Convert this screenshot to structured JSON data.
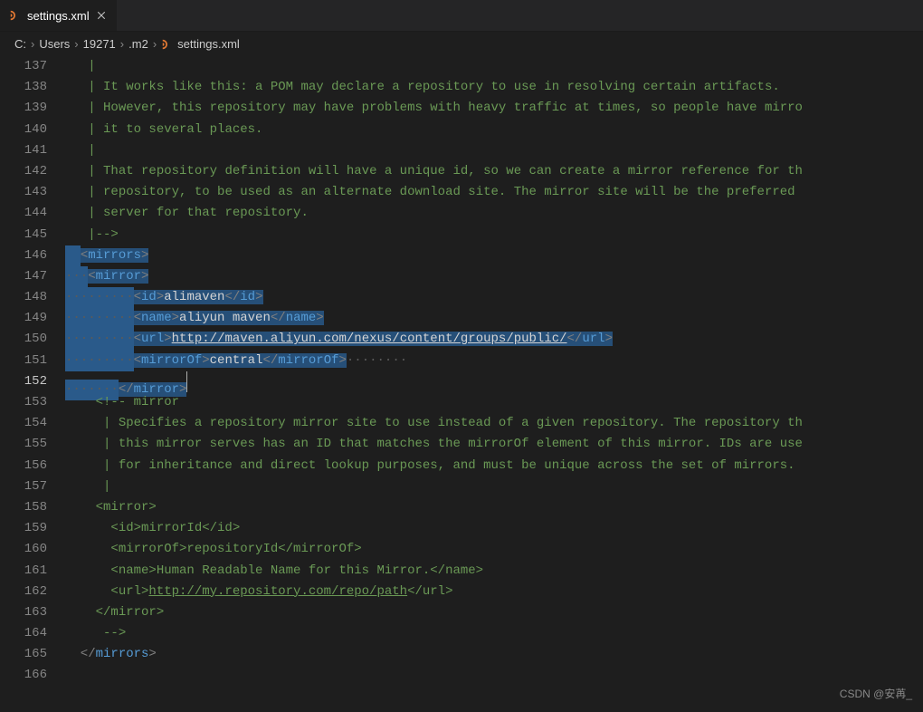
{
  "tab": {
    "filename": "settings.xml"
  },
  "breadcrumb": {
    "parts": [
      "C:",
      "Users",
      "19271",
      ".m2"
    ],
    "file": "settings.xml"
  },
  "lines": {
    "start": 137,
    "end": 166,
    "active": 152
  },
  "code": {
    "l137": "|",
    "l138": "| It works like this: a POM may declare a repository to use in resolving certain artifacts.",
    "l139": "| However, this repository may have problems with heavy traffic at times, so people have mirro",
    "l140": "| it to several places.",
    "l141": "|",
    "l142": "| That repository definition will have a unique id, so we can create a mirror reference for th",
    "l143": "| repository, to be used as an alternate download site. The mirror site will be the preferred",
    "l144": "| server for that repository.",
    "l145": "|-->",
    "mirrors_open": "mirrors",
    "mirror_open": "mirror",
    "id_tag": "id",
    "id_val": "alimaven",
    "name_tag": "name",
    "name_val": "aliyun maven",
    "url_tag": "url",
    "url_val": "http://maven.aliyun.com/nexus/content/groups/public/",
    "mirrorof_tag": "mirrorOf",
    "mirrorof_val": "central",
    "l153": "<!-- mirror",
    "l154": " | Specifies a repository mirror site to use instead of a given repository. The repository th",
    "l155": " | this mirror serves has an ID that matches the mirrorOf element of this mirror. IDs are use",
    "l156": " | for inheritance and direct lookup purposes, and must be unique across the set of mirrors.",
    "l157": " |",
    "l158": "<mirror>",
    "l159": "  <id>mirrorId</id>",
    "l160": "  <mirrorOf>repositoryId</mirrorOf>",
    "l161": "  <name>Human Readable Name for this Mirror.</name>",
    "l162a": "  <url>",
    "l162b": "http://my.repository.com/repo/path",
    "l162c": "</url>",
    "l163": "</mirror>",
    "l164": " -->",
    "mirrors_close": "mirrors"
  },
  "watermark": "CSDN @安苒_"
}
